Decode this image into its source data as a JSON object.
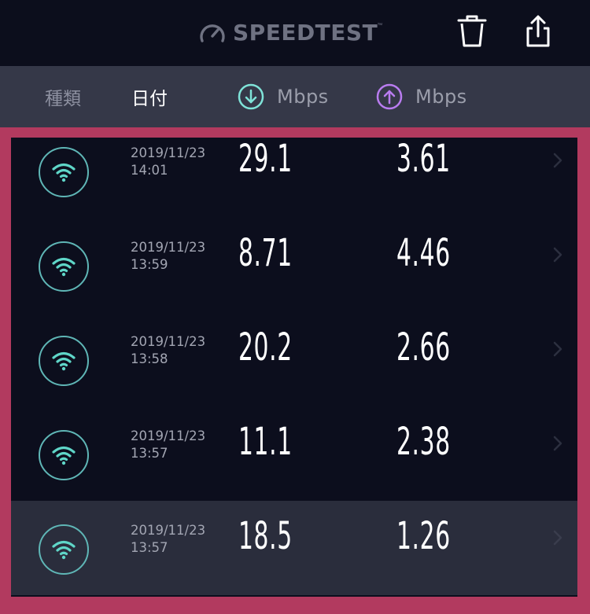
{
  "app": {
    "logo_text": "SPEEDTEST",
    "logo_tm": "™"
  },
  "toolbar": {
    "delete_icon": "trash-icon",
    "share_icon": "share-icon"
  },
  "columns": {
    "type": "種類",
    "date": "日付",
    "download_unit": "Mbps",
    "upload_unit": "Mbps",
    "download_icon": "arrow-down-circle-icon",
    "upload_icon": "arrow-up-circle-icon"
  },
  "colors": {
    "download_accent": "#7fe3d8",
    "upload_accent": "#b97cf0",
    "selection_frame": "#b23a5f",
    "wifi_accent": "#5fd6c8"
  },
  "results": [
    {
      "type_icon": "wifi-icon",
      "date": "2019/11/23",
      "time": "14:01",
      "download": "29.1",
      "upload": "3.61"
    },
    {
      "type_icon": "wifi-icon",
      "date": "2019/11/23",
      "time": "13:59",
      "download": "8.71",
      "upload": "4.46"
    },
    {
      "type_icon": "wifi-icon",
      "date": "2019/11/23",
      "time": "13:58",
      "download": "20.2",
      "upload": "2.66"
    },
    {
      "type_icon": "wifi-icon",
      "date": "2019/11/23",
      "time": "13:57",
      "download": "11.1",
      "upload": "2.38"
    },
    {
      "type_icon": "wifi-icon",
      "date": "2019/11/23",
      "time": "13:57",
      "download": "18.5",
      "upload": "1.26"
    }
  ]
}
